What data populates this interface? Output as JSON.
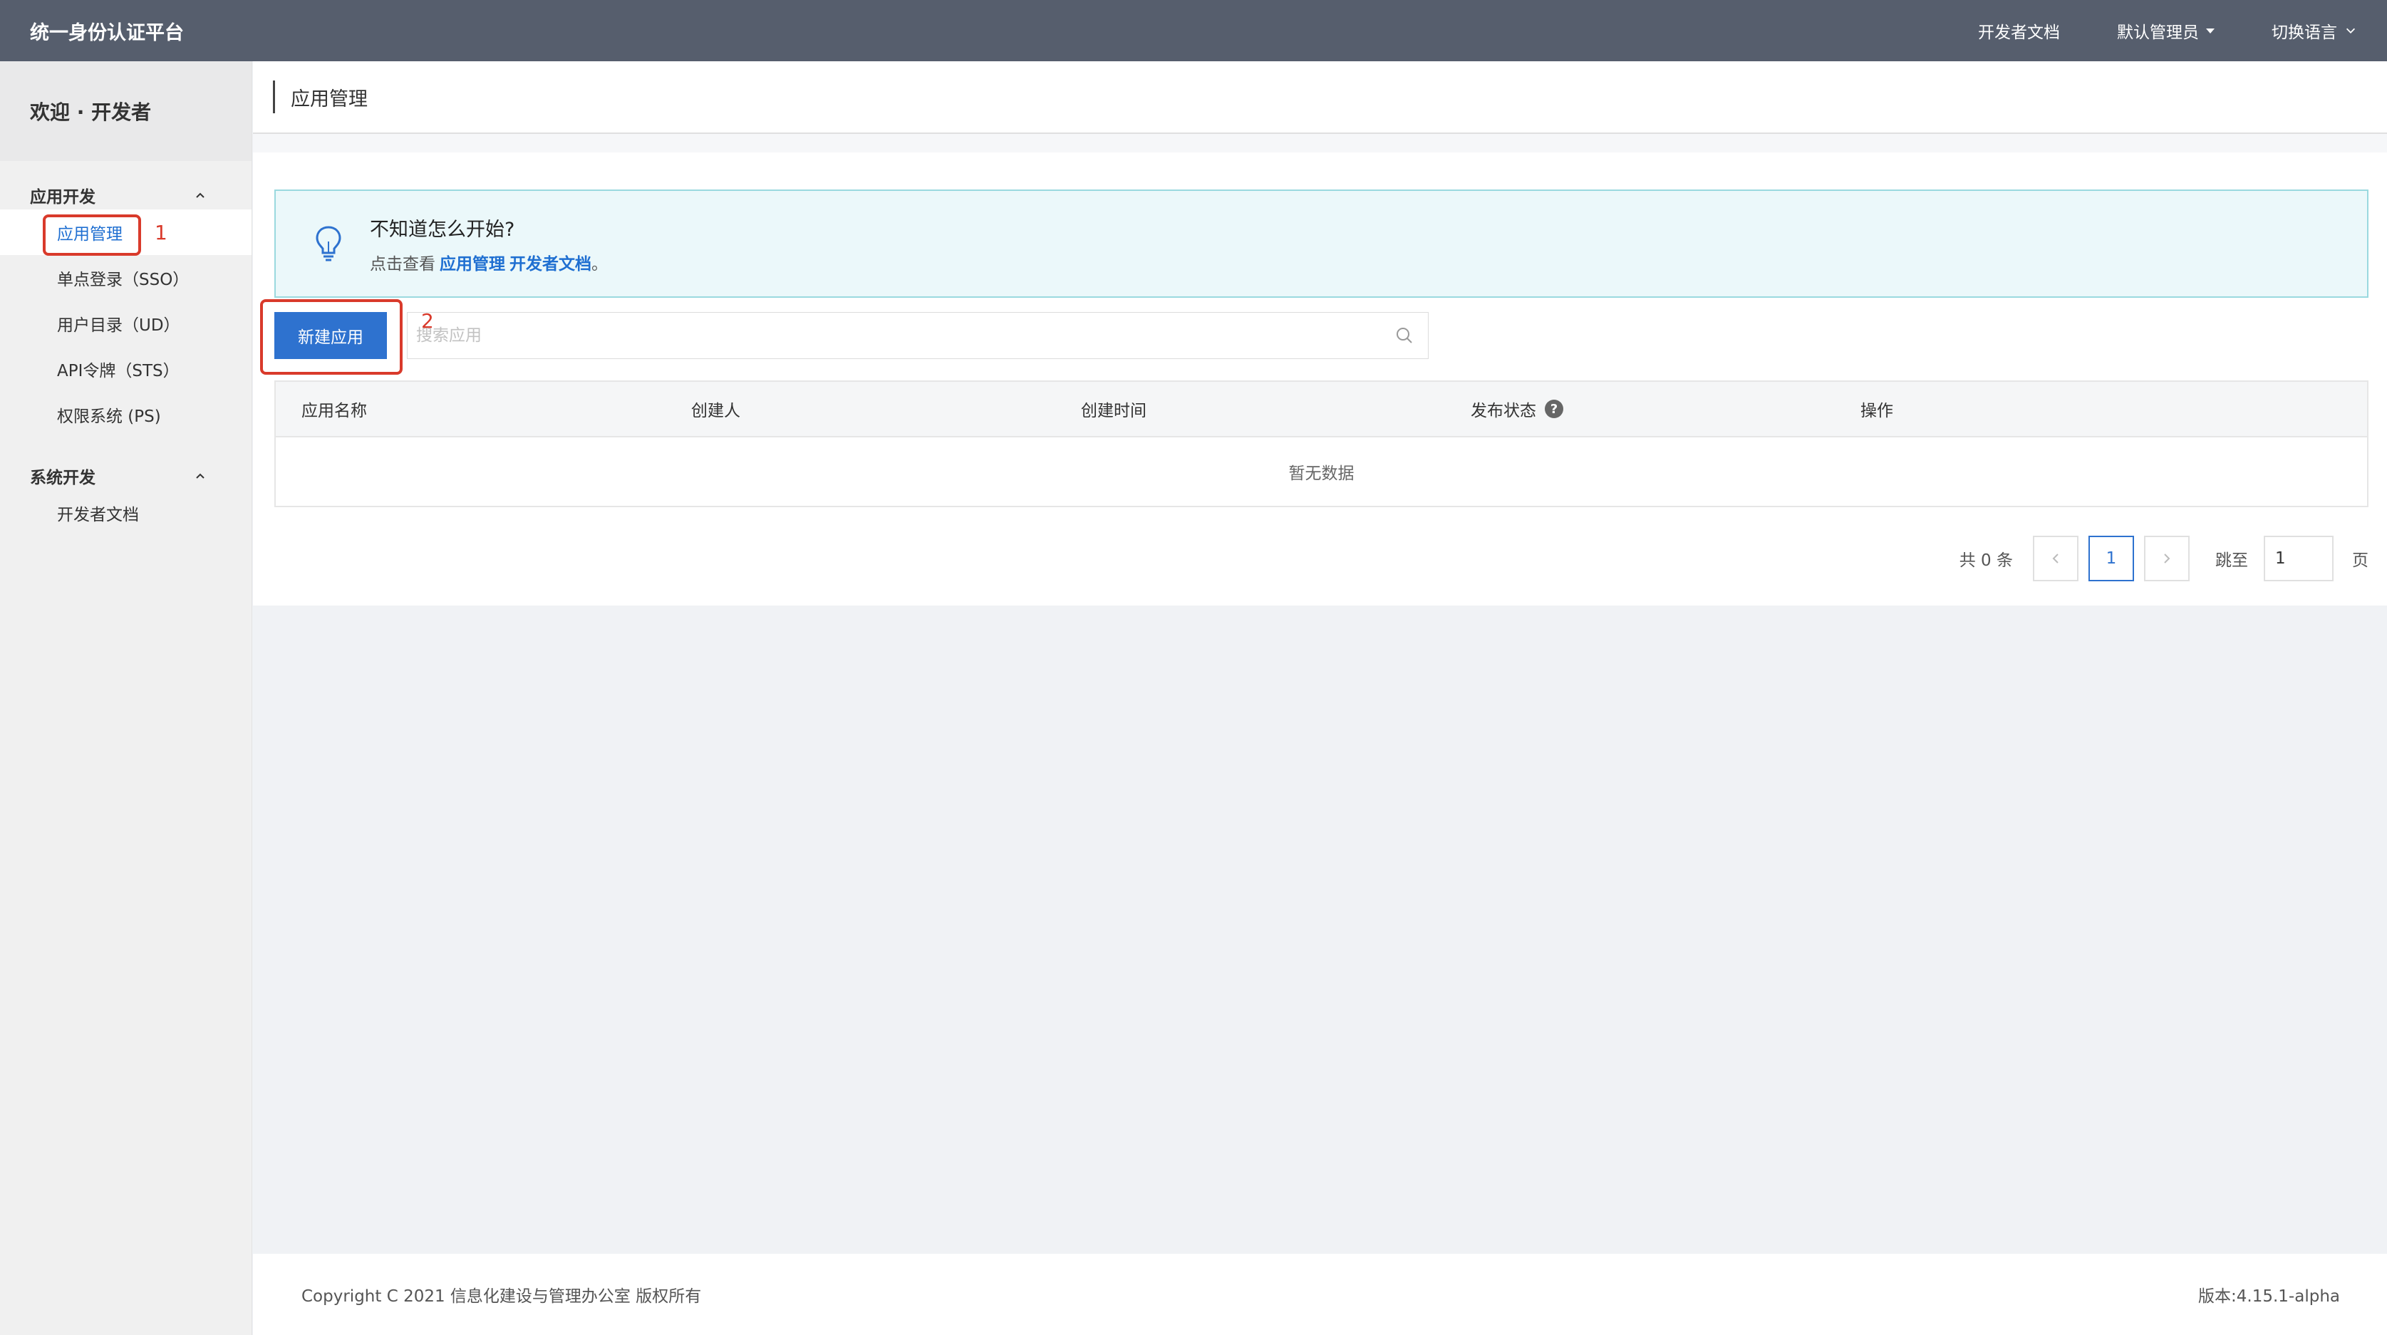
{
  "header": {
    "brand": "统一身份认证平台",
    "nav": {
      "docs": "开发者文档",
      "admin": "默认管理员",
      "language": "切换语言"
    }
  },
  "sidebar": {
    "welcome": "欢迎 · 开发者",
    "groups": [
      {
        "title": "应用开发",
        "items": [
          "应用管理",
          "单点登录（SSO）",
          "用户目录（UD）",
          "API令牌（STS）",
          "权限系统 (PS)"
        ]
      },
      {
        "title": "系统开发",
        "items": [
          "开发者文档"
        ]
      }
    ]
  },
  "page": {
    "title": "应用管理"
  },
  "hint": {
    "title": "不知道怎么开始?",
    "prefix": "点击查看",
    "link1": "应用管理",
    "link2": "开发者文档",
    "suffix": "。"
  },
  "toolbar": {
    "new_app": "新建应用",
    "search_placeholder": "搜索应用"
  },
  "table": {
    "columns": [
      "应用名称",
      "创建人",
      "创建时间",
      "发布状态",
      "操作"
    ],
    "rows": [],
    "empty_text": "暂无数据"
  },
  "pagination": {
    "total": "共 0 条",
    "current_page": "1",
    "jump_label": "跳至",
    "jump_value": "1",
    "page_unit": "页"
  },
  "annotations": {
    "one": "1",
    "two": "2"
  },
  "footer": {
    "copyright": "Copyright C 2021 信息化建设与管理办公室 版权所有",
    "version": "版本:4.15.1-alpha"
  },
  "colors": {
    "topbar": "#565e6d",
    "primary": "#2e72cf",
    "annotation": "#d93a2b",
    "hint_border": "#9ad9df"
  }
}
